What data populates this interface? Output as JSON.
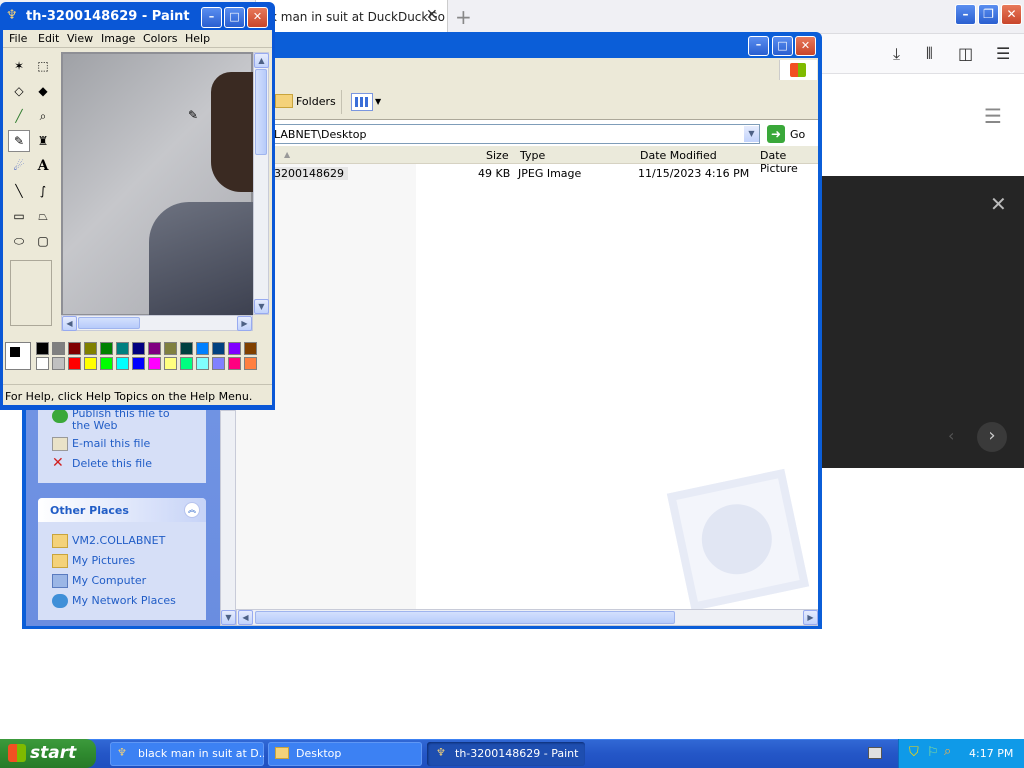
{
  "firefox": {
    "tab_title": "k man in suit at DuckDuckGo",
    "new_tab": "+",
    "close_tab": "✕",
    "window_controls": [
      "–",
      "❐",
      "✕"
    ]
  },
  "explorer": {
    "address": "LABNET\\Desktop",
    "go_label": "Go",
    "folders_label": "Folders",
    "columns": [
      "Size",
      "Type",
      "Date Modified",
      "Date Picture"
    ],
    "file": {
      "name": "3200148629",
      "size": "49 KB",
      "type": "JPEG Image",
      "modified": "11/15/2023 4:16 PM"
    },
    "tasks": [
      "Publish this file to the Web",
      "E-mail this file",
      "Delete this file"
    ],
    "other_places_title": "Other Places",
    "other_places": [
      "VM2.COLLABNET",
      "My Pictures",
      "My Computer",
      "My Network Places"
    ]
  },
  "paint": {
    "title": "th-3200148629 - Paint",
    "menu": [
      "File",
      "Edit",
      "View",
      "Image",
      "Colors",
      "Help"
    ],
    "status": "For Help, click Help Topics on the Help Menu.",
    "palette_top": [
      "#000000",
      "#808080",
      "#800000",
      "#808000",
      "#008000",
      "#008080",
      "#000080",
      "#800080",
      "#808040",
      "#004040",
      "#0080ff",
      "#004080",
      "#8000ff",
      "#804000"
    ],
    "palette_bottom": [
      "#ffffff",
      "#c0c0c0",
      "#ff0000",
      "#ffff00",
      "#00ff00",
      "#00ffff",
      "#0000ff",
      "#ff00ff",
      "#ffff80",
      "#00ff80",
      "#80ffff",
      "#8080ff",
      "#ff0080",
      "#ff8040"
    ]
  },
  "taskbar": {
    "start": "start",
    "buttons": [
      "black man in suit at D...",
      "Desktop",
      "th-3200148629 - Paint"
    ],
    "clock": "4:17 PM"
  }
}
